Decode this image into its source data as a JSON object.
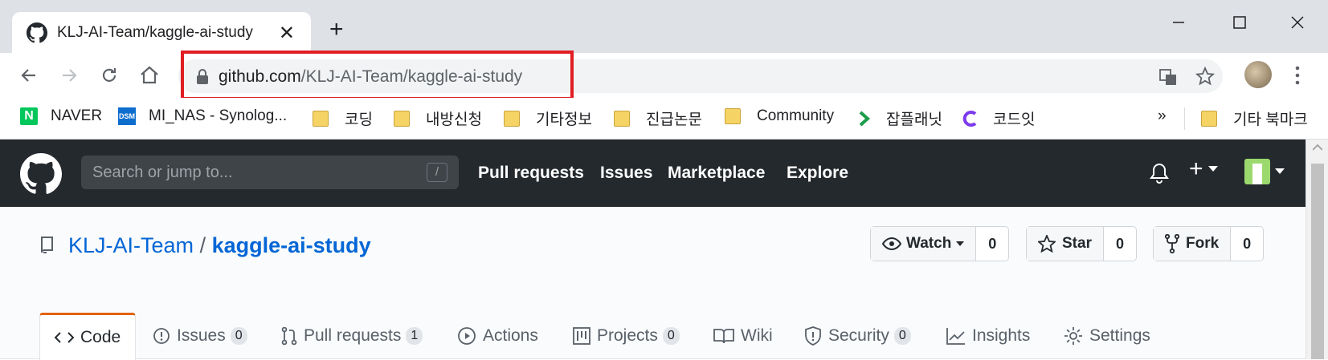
{
  "browser": {
    "tab_title": "KLJ-AI-Team/kaggle-ai-study",
    "tab_close": "✕",
    "new_tab": "+",
    "url_host": "github.com",
    "url_path": "/KLJ-AI-Team/kaggle-ai-study",
    "bookmarks": [
      {
        "label": "NAVER",
        "icon": "naver-icon"
      },
      {
        "label": "MI_NAS - Synolog...",
        "icon": "dsm-icon",
        "icon_text": "DSM"
      },
      {
        "label": "코딩",
        "icon": "folder-icon"
      },
      {
        "label": "내방신청",
        "icon": "folder-icon"
      },
      {
        "label": "기타정보",
        "icon": "folder-icon"
      },
      {
        "label": "진급논문",
        "icon": "folder-icon"
      },
      {
        "label": "Community",
        "icon": "folder-icon"
      },
      {
        "label": "잡플래닛",
        "icon": "jobplanet-icon"
      },
      {
        "label": "코드잇",
        "icon": "codeit-icon"
      }
    ],
    "bookmarks_more": "»",
    "other_bookmarks": "기타 북마크"
  },
  "github": {
    "search_placeholder": "Search or jump to...",
    "search_shortcut": "/",
    "nav": [
      "Pull requests",
      "Issues",
      "Marketplace",
      "Explore"
    ],
    "plus": "+"
  },
  "repo": {
    "owner": "KLJ-AI-Team",
    "separator": "/",
    "name": "kaggle-ai-study",
    "watch_label": "Watch",
    "watch_count": "0",
    "star_label": "Star",
    "star_count": "0",
    "fork_label": "Fork",
    "fork_count": "0",
    "tabs": [
      {
        "label": "Code"
      },
      {
        "label": "Issues",
        "count": "0"
      },
      {
        "label": "Pull requests",
        "count": "1"
      },
      {
        "label": "Actions"
      },
      {
        "label": "Projects",
        "count": "0"
      },
      {
        "label": "Wiki"
      },
      {
        "label": "Security",
        "count": "0"
      },
      {
        "label": "Insights"
      },
      {
        "label": "Settings"
      }
    ]
  },
  "colors": {
    "highlight": "#e01e24",
    "header_bg": "#24292e",
    "link": "#0366d6",
    "active_tab_border": "#e36209"
  }
}
